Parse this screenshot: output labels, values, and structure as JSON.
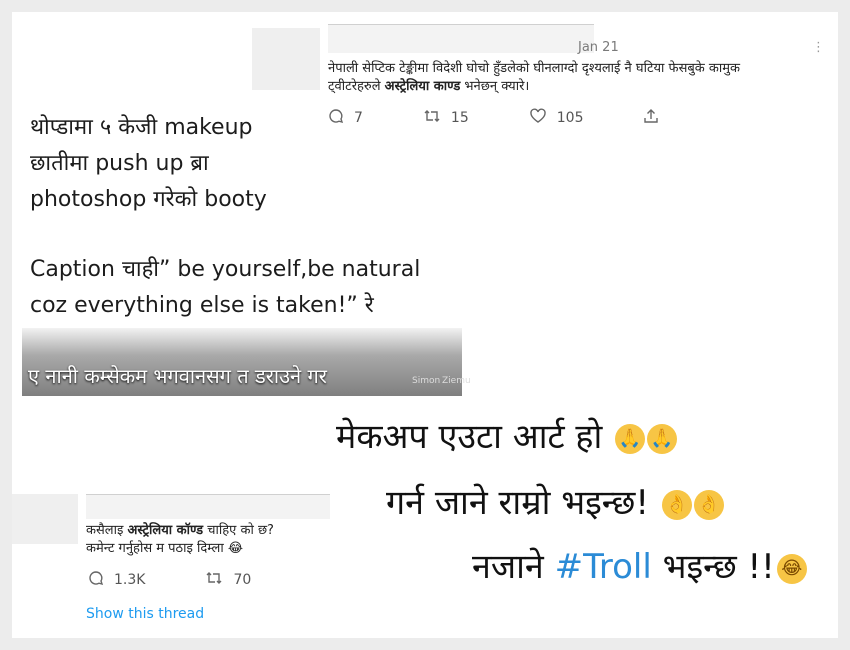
{
  "top_tweet": {
    "date": "Jan 21",
    "text_line1": "नेपाली सेप्टिक टेङ्कीमा विदेशी घोचो हुँडलेको घीनलाग्दो दृश्यलाई नै घटिया फेसबुके कामुक",
    "text_line2_pre": "ट्वीटरेहरुले ",
    "text_line2_bold": "अस्ट्रेलिया काण्ड",
    "text_line2_post": " भनेछन् क्यारे।",
    "reply_count": "7",
    "retweet_count": "15",
    "like_count": "105",
    "more": "⋮"
  },
  "left_text": {
    "line1": "थोप्डामा ५ केजी makeup",
    "line2": "छातीमा push up ब्रा",
    "line3": "photoshop गरेको booty",
    "line4": "Caption चाही” be yourself,be natural",
    "line5": "coz everything else is taken!” रे"
  },
  "strip": {
    "text": "ए नानी कम्सेकम भगवानसग त डराउने गर",
    "meta1": "Simon",
    "meta2": "Ziemu"
  },
  "quote": {
    "line1": "मेकअप एउटा  आर्ट हो",
    "line2": "गर्न जाने राम्रो भइन्छ!",
    "line3_pre": "नजाने ",
    "line3_hash": "#Troll",
    "line3_post": "  भइन्छ  !!"
  },
  "bottom_tweet": {
    "text_line1_pre": "कसैलाइ ",
    "text_line1_bold": "अस्ट्रेलिया कॉण्ड",
    "text_line1_post": " चाहिए को छ?",
    "text_line2": "कमेन्ट गर्नुहोस म पठाइ दिम्ला 😂",
    "reply_count": "1.3K",
    "retweet_count": "70",
    "show_thread": "Show this thread"
  },
  "icons": {
    "reply": "reply-icon",
    "retweet": "retweet-icon",
    "like": "heart-icon",
    "share": "share-icon",
    "pray": "praying-hands-emoji",
    "ok": "ok-hand-emoji"
  }
}
